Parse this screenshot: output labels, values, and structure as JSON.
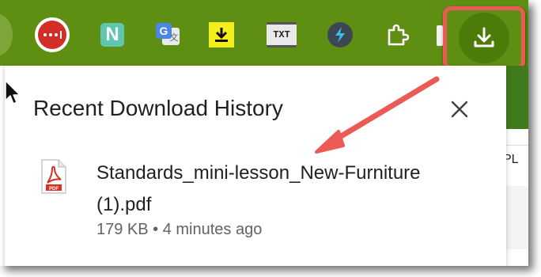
{
  "toolbar": {
    "extensions": [
      {
        "name": "lastpass-icon"
      },
      {
        "name": "n-extension-icon",
        "glyph": "N"
      },
      {
        "name": "translate-icon"
      },
      {
        "name": "yellow-download-icon"
      },
      {
        "name": "txt-extension-icon",
        "glyph": "TXT"
      },
      {
        "name": "lightning-icon"
      },
      {
        "name": "puzzle-icon"
      }
    ],
    "download_button": {
      "icon": "download-icon"
    }
  },
  "popup": {
    "title": "Recent Download History",
    "close_icon": "close-icon",
    "item": {
      "file_name": "Standards_mini-lesson_New-Furniture (1).pdf",
      "meta": "179 KB • 4 minutes ago",
      "icon": "pdf-file-icon"
    }
  },
  "background": {
    "partial_text": "PL"
  },
  "colors": {
    "toolbar_green": "#5f8f12",
    "highlight_red": "#ec5a56",
    "title_text": "#202124",
    "meta_text": "#5f6368"
  }
}
